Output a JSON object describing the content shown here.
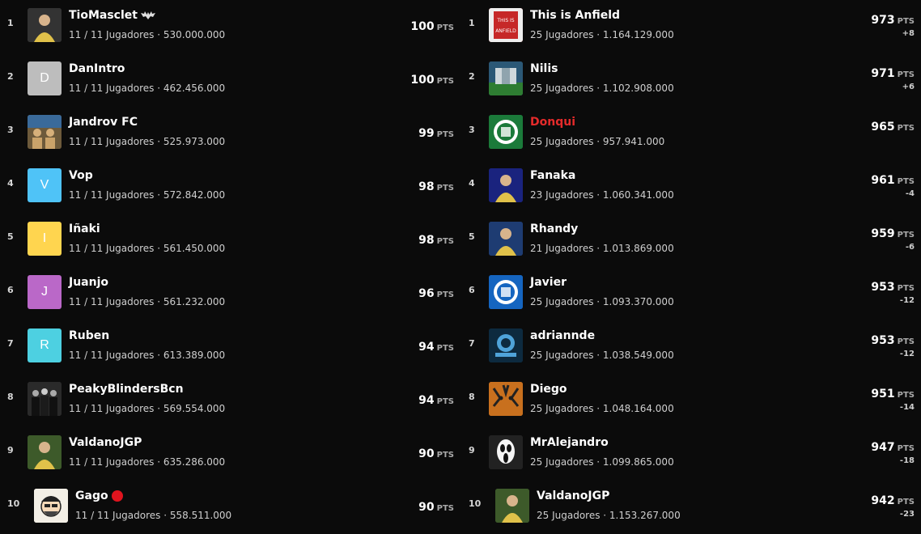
{
  "pts_unit": "PTS",
  "left": [
    {
      "rank": "1",
      "name": "TioMasclet",
      "sub": "11 / 11 Jugadores · 530.000.000",
      "pts": "100",
      "avatar": {
        "type": "image",
        "icon": "player-photo-icon",
        "bg": "#333"
      },
      "badge": "bat-icon"
    },
    {
      "rank": "2",
      "name": "DanIntro",
      "sub": "11 / 11 Jugadores · 462.456.000",
      "pts": "100",
      "avatar": {
        "type": "letter",
        "letter": "D",
        "bg": "#bdbdbd"
      }
    },
    {
      "rank": "3",
      "name": "Jandrov FC",
      "sub": "11 / 11 Jugadores · 525.973.000",
      "pts": "99",
      "avatar": {
        "type": "image",
        "icon": "team-photo-icon",
        "bg": "#6d5a3b"
      }
    },
    {
      "rank": "4",
      "name": "Vop",
      "sub": "11 / 11 Jugadores · 572.842.000",
      "pts": "98",
      "avatar": {
        "type": "letter",
        "letter": "V",
        "bg": "#4fc3f7"
      }
    },
    {
      "rank": "5",
      "name": "Iñaki",
      "sub": "11 / 11 Jugadores · 561.450.000",
      "pts": "98",
      "avatar": {
        "type": "letter",
        "letter": "I",
        "bg": "#ffd54f"
      }
    },
    {
      "rank": "6",
      "name": "Juanjo",
      "sub": "11 / 11 Jugadores · 561.232.000",
      "pts": "96",
      "avatar": {
        "type": "letter",
        "letter": "J",
        "bg": "#ba68c8"
      }
    },
    {
      "rank": "7",
      "name": "Ruben",
      "sub": "11 / 11 Jugadores · 613.389.000",
      "pts": "94",
      "avatar": {
        "type": "letter",
        "letter": "R",
        "bg": "#4dd0e1"
      }
    },
    {
      "rank": "8",
      "name": "PeakyBlindersBcn",
      "sub": "11 / 11 Jugadores · 569.554.000",
      "pts": "94",
      "avatar": {
        "type": "image",
        "icon": "group-photo-icon",
        "bg": "#2a2a2a"
      }
    },
    {
      "rank": "9",
      "name": "ValdanoJGP",
      "sub": "11 / 11 Jugadores · 635.286.000",
      "pts": "90",
      "avatar": {
        "type": "image",
        "icon": "player-photo-icon",
        "bg": "#3d5a2a"
      }
    },
    {
      "rank": "10",
      "name": "Gago",
      "sub": "11 / 11 Jugadores · 558.511.000",
      "pts": "90",
      "avatar": {
        "type": "image",
        "icon": "cartoon-face-icon",
        "bg": "#f3efe6"
      },
      "badge": "red-dot-icon"
    }
  ],
  "right": [
    {
      "rank": "1",
      "name": "This is Anfield",
      "sub": "25 Jugadores · 1.164.129.000",
      "pts": "973",
      "delta": "+8",
      "avatar": {
        "type": "image",
        "icon": "anfield-sign-icon",
        "bg": "#c62828"
      }
    },
    {
      "rank": "2",
      "name": "Nilis",
      "sub": "25 Jugadores · 1.102.908.000",
      "pts": "971",
      "delta": "+6",
      "avatar": {
        "type": "image",
        "icon": "stadium-photo-icon",
        "bg": "#2b5876"
      }
    },
    {
      "rank": "3",
      "name": "Donqui",
      "sub": "25 Jugadores · 957.941.000",
      "pts": "965",
      "delta": "",
      "highlight": true,
      "avatar": {
        "type": "image",
        "icon": "club-crest-icon",
        "bg": "#1b7a3a"
      }
    },
    {
      "rank": "4",
      "name": "Fanaka",
      "sub": "23 Jugadores · 1.060.341.000",
      "pts": "961",
      "delta": "-4",
      "avatar": {
        "type": "image",
        "icon": "player-photo-icon",
        "bg": "#1a237e"
      }
    },
    {
      "rank": "5",
      "name": "Rhandy",
      "sub": "21 Jugadores · 1.013.869.000",
      "pts": "959",
      "delta": "-6",
      "avatar": {
        "type": "image",
        "icon": "player-photo-icon",
        "bg": "#1e3c72"
      }
    },
    {
      "rank": "6",
      "name": "Javier",
      "sub": "25 Jugadores · 1.093.370.000",
      "pts": "953",
      "delta": "-12",
      "avatar": {
        "type": "image",
        "icon": "club-crest-icon",
        "bg": "#1565c0"
      }
    },
    {
      "rank": "7",
      "name": "adriannde",
      "sub": "25 Jugadores · 1.038.549.000",
      "pts": "953",
      "delta": "-12",
      "avatar": {
        "type": "image",
        "icon": "team-logo-icon",
        "bg": "#0d2a3f"
      }
    },
    {
      "rank": "8",
      "name": "Diego",
      "sub": "25 Jugadores · 1.048.164.000",
      "pts": "951",
      "delta": "-14",
      "avatar": {
        "type": "image",
        "icon": "tiger-photo-icon",
        "bg": "#c8701e"
      }
    },
    {
      "rank": "9",
      "name": "MrAlejandro",
      "sub": "25 Jugadores · 1.099.865.000",
      "pts": "947",
      "delta": "-18",
      "avatar": {
        "type": "image",
        "icon": "ghostface-mask-icon",
        "bg": "#222"
      }
    },
    {
      "rank": "10",
      "name": "ValdanoJGP",
      "sub": "25 Jugadores · 1.153.267.000",
      "pts": "942",
      "delta": "-23",
      "avatar": {
        "type": "image",
        "icon": "player-photo-icon",
        "bg": "#3d5a2a"
      }
    }
  ]
}
